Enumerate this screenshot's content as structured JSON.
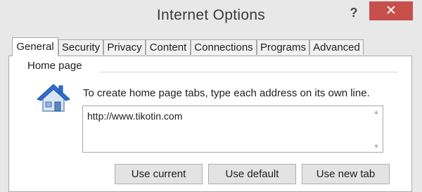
{
  "window": {
    "title": "Internet Options",
    "help_label": "?",
    "close_label": "✕"
  },
  "tabs": [
    {
      "label": "General",
      "active": true
    },
    {
      "label": "Security",
      "active": false
    },
    {
      "label": "Privacy",
      "active": false
    },
    {
      "label": "Content",
      "active": false
    },
    {
      "label": "Connections",
      "active": false
    },
    {
      "label": "Programs",
      "active": false
    },
    {
      "label": "Advanced",
      "active": false
    }
  ],
  "home_page": {
    "group_title": "Home page",
    "icon": "house-icon",
    "instruction": "To create home page tabs, type each address on its own line.",
    "url_value": "http://www.tikotin.com",
    "buttons": {
      "use_current": "Use current",
      "use_default": "Use default",
      "use_new_tab": "Use new tab"
    }
  },
  "colors": {
    "dialog_bg": "#e8e8e8",
    "close_button": "#c7504c",
    "house_roof": "#2f6fd0",
    "house_wall": "#d8e6f5"
  }
}
